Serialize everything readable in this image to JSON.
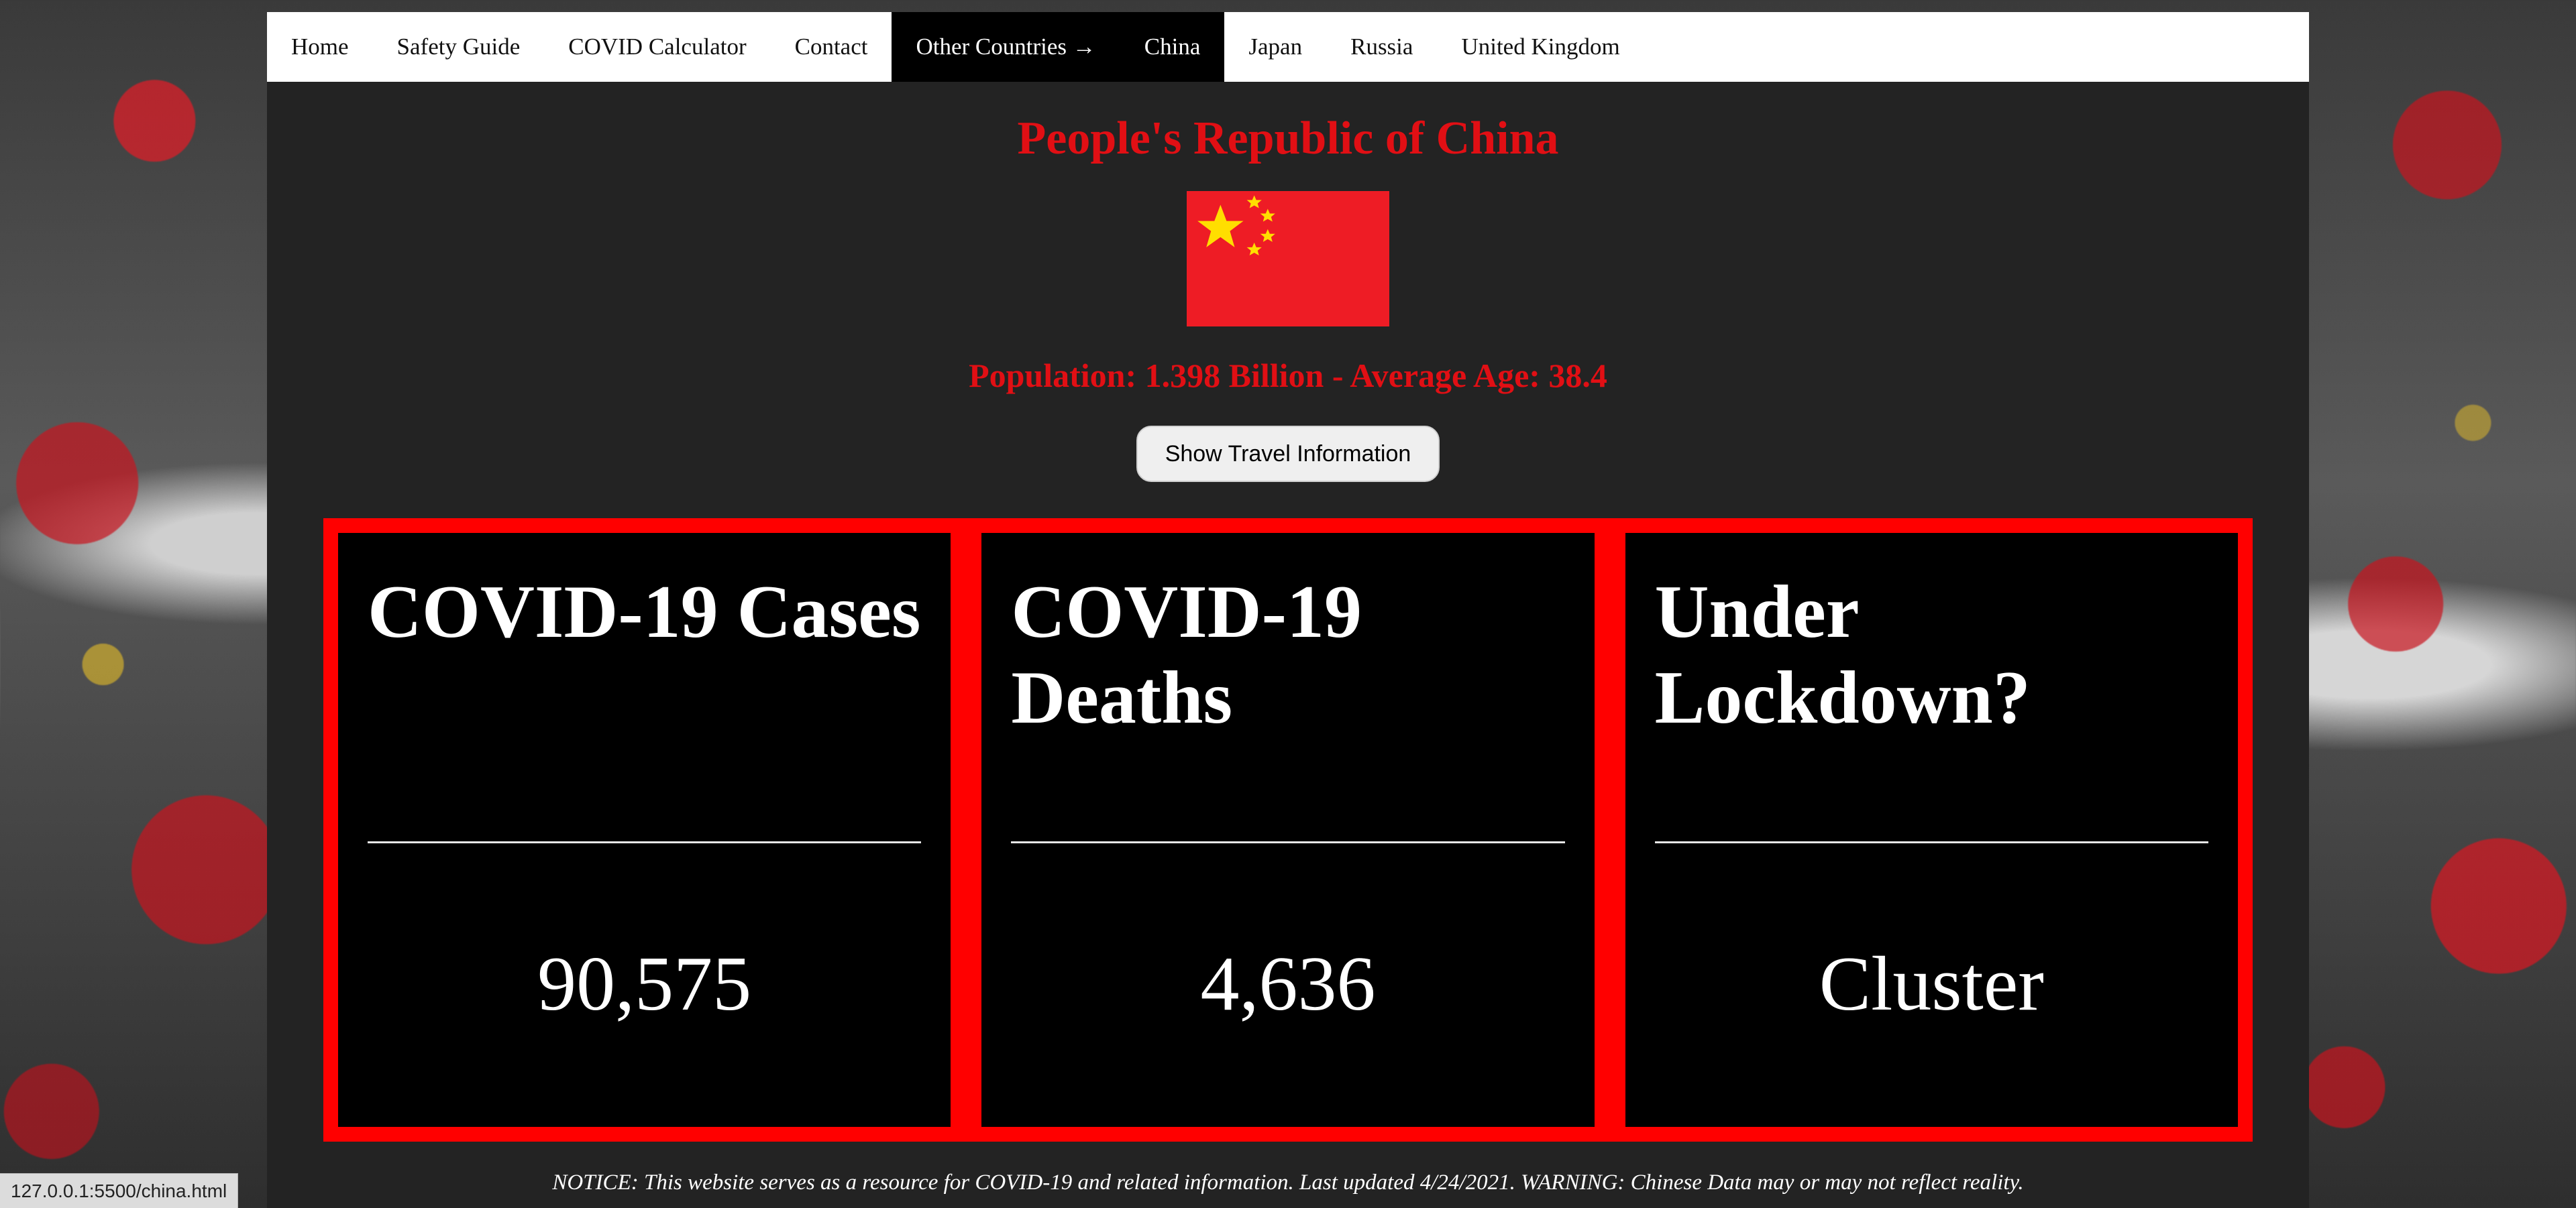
{
  "nav": {
    "items": [
      {
        "label": "Home"
      },
      {
        "label": "Safety Guide"
      },
      {
        "label": "COVID Calculator"
      },
      {
        "label": "Contact"
      },
      {
        "label": "Other Countries →"
      },
      {
        "label": "China"
      },
      {
        "label": "Japan"
      },
      {
        "label": "Russia"
      },
      {
        "label": "United Kingdom"
      }
    ]
  },
  "country": {
    "title": "People's Republic of China",
    "population_line": "Population: 1.398 Billion - Average Age: 38.4",
    "flag_icon": "china-flag-icon"
  },
  "travel_button": {
    "label": "Show Travel Information"
  },
  "cards": [
    {
      "title": "COVID-19 Cases",
      "value": "90,575"
    },
    {
      "title": "COVID-19 Deaths",
      "value": "4,636"
    },
    {
      "title": "Under Lockdown?",
      "value": "Cluster"
    }
  ],
  "notice": "NOTICE: This website serves as a resource for COVID-19 and related information. Last updated 4/24/2021. WARNING: Chinese Data may or may not reflect reality.",
  "status_url": "127.0.0.1:5500/china.html",
  "colors": {
    "accent_red": "#e10f14",
    "card_border": "#ff0000",
    "flag_red": "#ee1c25",
    "flag_star": "#ffde00"
  }
}
